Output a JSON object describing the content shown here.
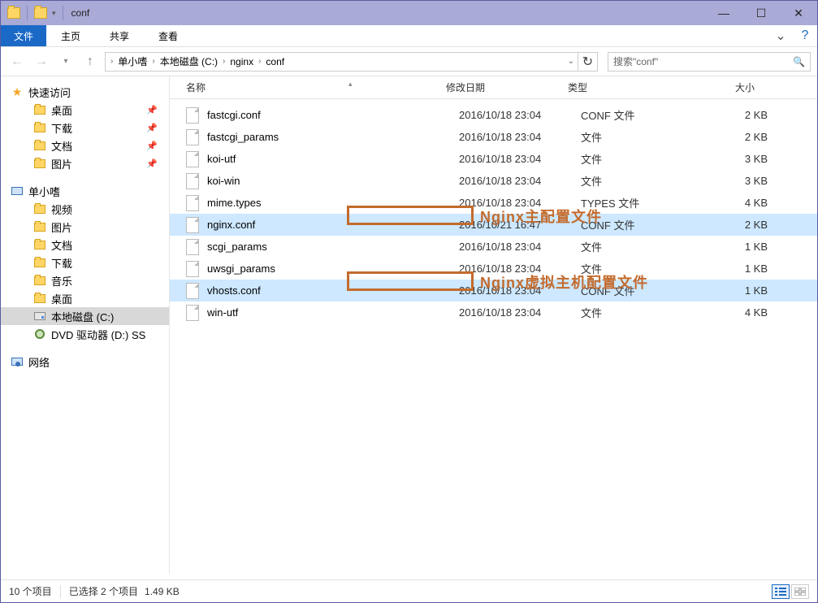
{
  "window": {
    "title": "conf"
  },
  "ribbon": {
    "file": "文件",
    "tabs": [
      "主页",
      "共享",
      "查看"
    ]
  },
  "breadcrumb": [
    "单小嗜",
    "本地磁盘 (C:)",
    "nginx",
    "conf"
  ],
  "search": {
    "placeholder": "搜索\"conf\""
  },
  "tree": {
    "quick_access": "快速访问",
    "quick_items": [
      {
        "label": "桌面"
      },
      {
        "label": "下载"
      },
      {
        "label": "文档"
      },
      {
        "label": "图片"
      }
    ],
    "this_pc": "单小嗜",
    "pc_items": [
      {
        "label": "视频"
      },
      {
        "label": "图片"
      },
      {
        "label": "文档"
      },
      {
        "label": "下载"
      },
      {
        "label": "音乐"
      },
      {
        "label": "桌面"
      },
      {
        "label": "本地磁盘 (C:)",
        "selected": true,
        "drive": true
      },
      {
        "label": "DVD 驱动器 (D:) SS",
        "dvd": true
      }
    ],
    "network": "网络"
  },
  "columns": {
    "name": "名称",
    "date": "修改日期",
    "type": "类型",
    "size": "大小"
  },
  "files": [
    {
      "name": "fastcgi.conf",
      "date": "2016/10/18 23:04",
      "type": "CONF 文件",
      "size": "2 KB",
      "sel": false
    },
    {
      "name": "fastcgi_params",
      "date": "2016/10/18 23:04",
      "type": "文件",
      "size": "2 KB",
      "sel": false
    },
    {
      "name": "koi-utf",
      "date": "2016/10/18 23:04",
      "type": "文件",
      "size": "3 KB",
      "sel": false
    },
    {
      "name": "koi-win",
      "date": "2016/10/18 23:04",
      "type": "文件",
      "size": "3 KB",
      "sel": false
    },
    {
      "name": "mime.types",
      "date": "2016/10/18 23:04",
      "type": "TYPES 文件",
      "size": "4 KB",
      "sel": false
    },
    {
      "name": "nginx.conf",
      "date": "2016/10/21 16:47",
      "type": "CONF 文件",
      "size": "2 KB",
      "sel": true
    },
    {
      "name": "scgi_params",
      "date": "2016/10/18 23:04",
      "type": "文件",
      "size": "1 KB",
      "sel": false
    },
    {
      "name": "uwsgi_params",
      "date": "2016/10/18 23:04",
      "type": "文件",
      "size": "1 KB",
      "sel": false
    },
    {
      "name": "vhosts.conf",
      "date": "2016/10/18 23:04",
      "type": "CONF 文件",
      "size": "1 KB",
      "sel": true
    },
    {
      "name": "win-utf",
      "date": "2016/10/18 23:04",
      "type": "文件",
      "size": "4 KB",
      "sel": false
    }
  ],
  "annotations": {
    "a1": "Nginx主配置文件",
    "a2": "Nginx虚拟主机配置文件"
  },
  "status": {
    "count": "10 个项目",
    "selected": "已选择 2 个项目",
    "size": "1.49 KB"
  }
}
